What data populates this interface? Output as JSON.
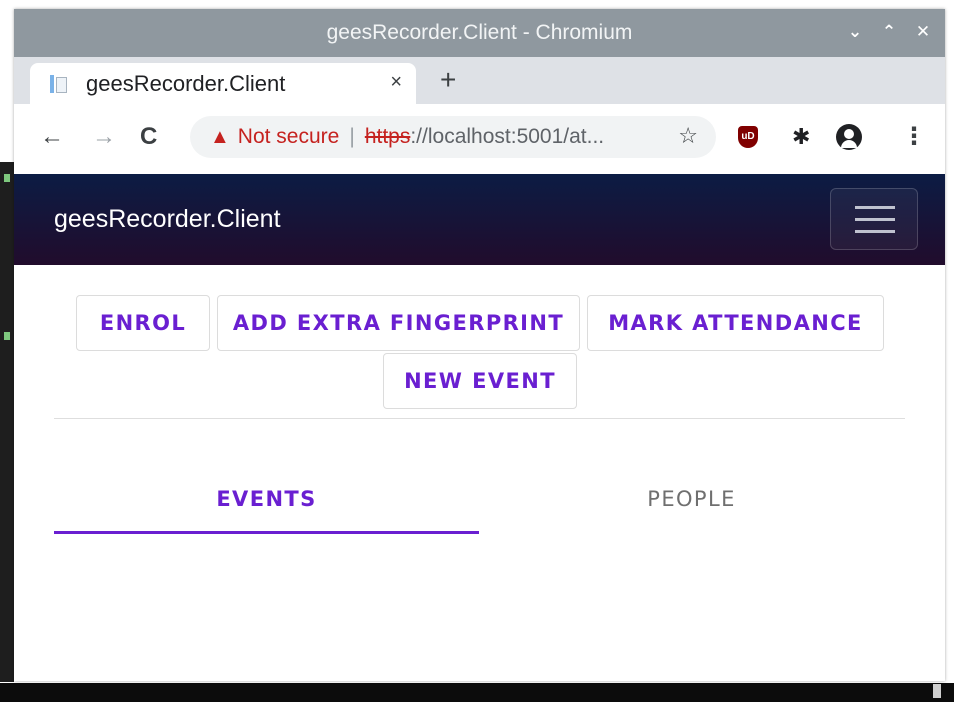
{
  "window": {
    "title": "geesRecorder.Client - Chromium",
    "controls": {
      "minimize": "⌄",
      "maximize": "⌃",
      "close": "✕"
    }
  },
  "browser": {
    "tab": {
      "title": "geesRecorder.Client",
      "close": "×"
    },
    "new_tab": "+",
    "nav": {
      "back": "←",
      "forward": "→",
      "reload": "C"
    },
    "address": {
      "warning_icon": "▲",
      "security_label": "Not secure",
      "separator": "|",
      "scheme": "https",
      "rest": "://localhost:5001/at...",
      "bookmark_icon": "☆"
    },
    "extensions": {
      "ublock_label": "uD",
      "puzzle_icon": "✱",
      "menu": "⋮"
    }
  },
  "app": {
    "brand": "geesRecorder.Client",
    "actions": {
      "enrol": "ENROL",
      "add_fingerprint": "ADD EXTRA FINGERPRINT",
      "mark_attendance": "MARK ATTENDANCE",
      "new_event": "NEW EVENT"
    },
    "tabs": {
      "events": "EVENTS",
      "people": "PEOPLE"
    },
    "active_tab": "EVENTS",
    "colors": {
      "accent": "#6a1fd1",
      "appbar_top": "#0c1c44",
      "appbar_bottom": "#210c2c"
    }
  }
}
